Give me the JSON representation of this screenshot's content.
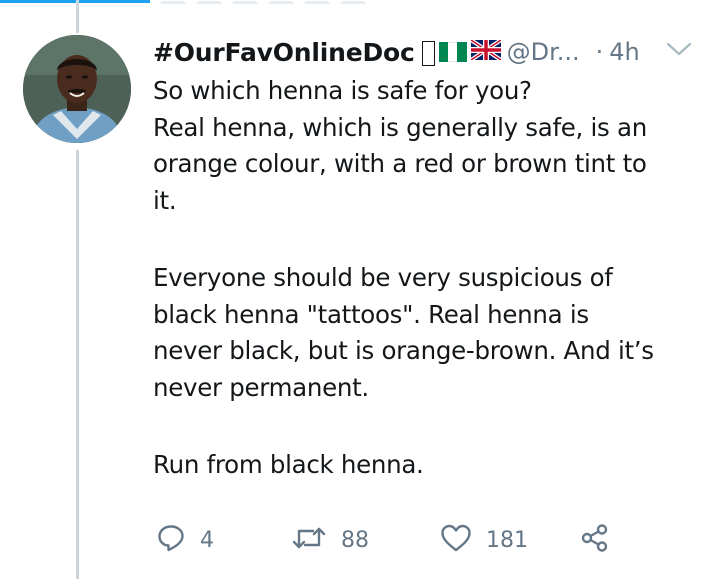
{
  "tweet": {
    "display_name": "#OurFavOnlineDoc",
    "handle": "@Dr...",
    "dot": "·",
    "time": "4h",
    "body": {
      "p1_line1": "So which henna is safe for you?",
      "p1_line2": "Real henna, which is generally safe, is an",
      "p1_line3": "orange colour, with a red or brown tint to",
      "p1_line4": "it.",
      "p2_line1": "Everyone should be very suspicious of",
      "p2_line2": "black henna \"tattoos\". Real henna is",
      "p2_line3": "never black, but is orange-brown. And it’s",
      "p2_line4": "never permanent.",
      "p3_line1": "Run from black henna."
    },
    "actions": {
      "replies": "4",
      "retweets": "88",
      "likes": "181"
    },
    "icons": {
      "avatar": "profile-photo",
      "unknown_emoji": "missing-glyph-box",
      "flag_1": "nigeria-flag",
      "flag_2": "united-kingdom-flag",
      "menu": "chevron-down-icon",
      "reply": "reply-bubble-icon",
      "retweet": "retweet-icon",
      "like": "heart-icon",
      "share": "share-icon"
    },
    "colors": {
      "text": "#14171a",
      "secondary": "#657786",
      "thread_line": "#ccd6dd",
      "accent": "#1da1f2",
      "nigeria_green": "#008751"
    }
  }
}
